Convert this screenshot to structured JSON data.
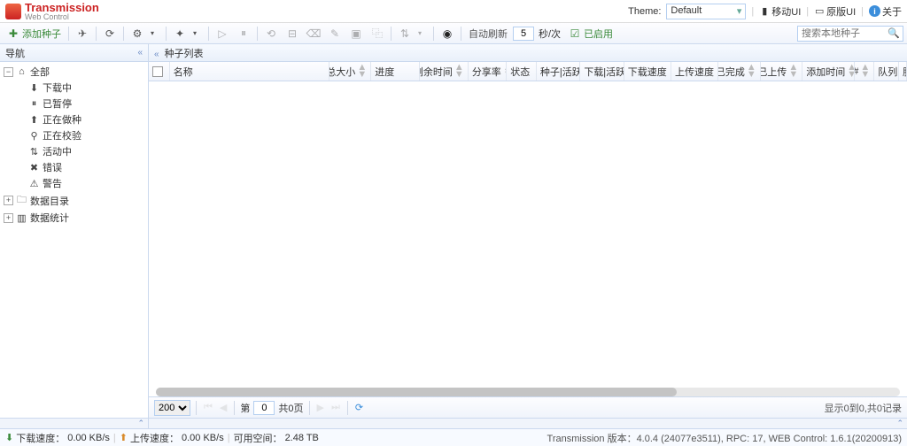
{
  "logo": {
    "title": "Transmission",
    "subtitle": "Web Control"
  },
  "header": {
    "theme_label": "Theme:",
    "theme_value": "Default",
    "mobile_ui": "移动UI",
    "original_ui": "原版UI",
    "about": "关于"
  },
  "toolbar": {
    "add_torrent": "添加种子",
    "auto_refresh": "自动刷新",
    "interval": "5",
    "interval_unit": "秒/次",
    "enabled": "已启用",
    "search_placeholder": "搜索本地种子"
  },
  "sidebar": {
    "title": "导航",
    "items": {
      "all": "全部",
      "downloading": "下载中",
      "paused": "已暂停",
      "seeding": "正在做种",
      "checking": "正在校验",
      "active": "活动中",
      "error": "错误",
      "warning": "警告",
      "data_dir": "数据目录",
      "stats": "数据统计"
    }
  },
  "grid": {
    "title": "种子列表",
    "cols": {
      "name": "名称",
      "size": "总大小",
      "progress": "进度",
      "remaining": "剩余时间",
      "ratio": "分享率",
      "status": "状态",
      "seeds": "种子|活跃",
      "peers": "下载|活跃",
      "dl": "下载速度",
      "ul": "上传速度",
      "done": "已完成",
      "uploaded": "已上传",
      "added": "添加时间",
      "num": "#",
      "queue": "队列",
      "server": "服务器"
    }
  },
  "pager": {
    "size": "200",
    "page_label_pre": "第",
    "page": "0",
    "total": "共0页",
    "info": "显示0到0,共0记录"
  },
  "status": {
    "dl_label": "下载速度：",
    "dl": "0.00 KB/s",
    "ul_label": "上传速度：",
    "ul": "0.00 KB/s",
    "space_label": "可用空间：",
    "space": "2.48 TB",
    "version": "Transmission 版本：4.0.4 (24077e3511), RPC: 17, WEB Control: 1.6.1(20200913)"
  }
}
